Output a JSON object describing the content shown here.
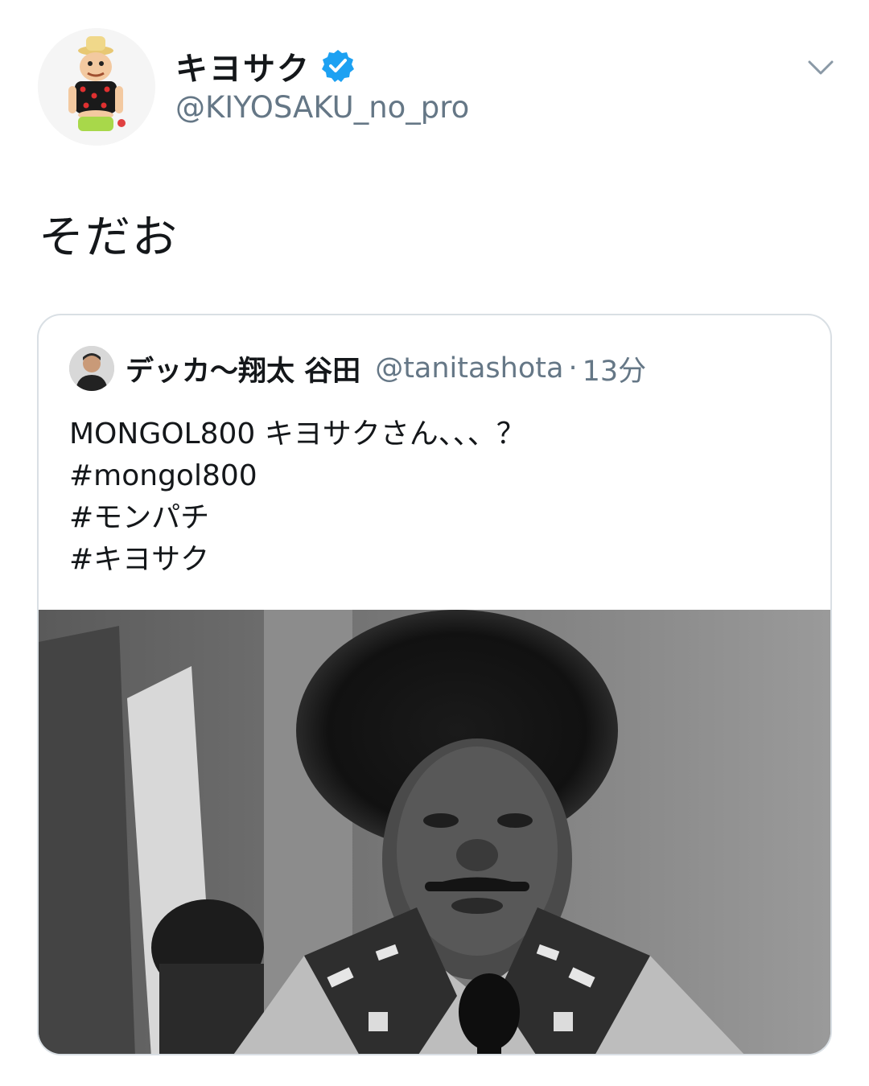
{
  "author": {
    "display_name": "キヨサク",
    "handle": "@KIYOSAKU_no_pro",
    "verified": true,
    "avatar_icon": "cartoon-character-avatar"
  },
  "menu_icon": "chevron-down-icon",
  "tweet": {
    "text": "そだお"
  },
  "quoted_tweet": {
    "author_name": "デッカ〜翔太 谷田",
    "author_handle": "@tanitashota",
    "separator": "·",
    "time": "13分",
    "lines": [
      "MONGOL800 キヨサクさん、、、？",
      "#mongol800",
      "#モンパチ",
      "#キヨサク"
    ],
    "media_icon": "photo-black-and-white-man"
  },
  "colors": {
    "text_primary": "#14171a",
    "text_secondary": "#657786",
    "verified_blue": "#1da1f2",
    "card_border": "#d9dfe4"
  }
}
